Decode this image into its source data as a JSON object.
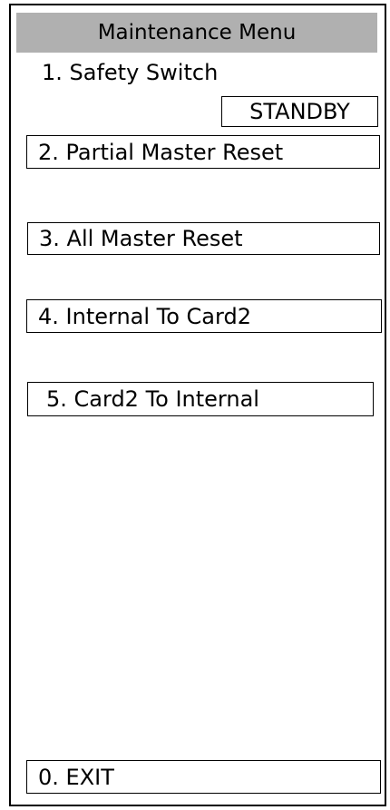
{
  "header": {
    "title": "Maintenance Menu",
    "background": "#b0b0b0"
  },
  "items": {
    "safety_switch": {
      "label": "1. Safety Switch",
      "status": "STANDBY"
    },
    "partial_master_reset": "2. Partial Master Reset",
    "all_master_reset": "3. All Master Reset",
    "internal_to_card2": "4. Internal To Card2",
    "card2_to_internal": "5. Card2 To Internal",
    "exit": "0. EXIT"
  }
}
